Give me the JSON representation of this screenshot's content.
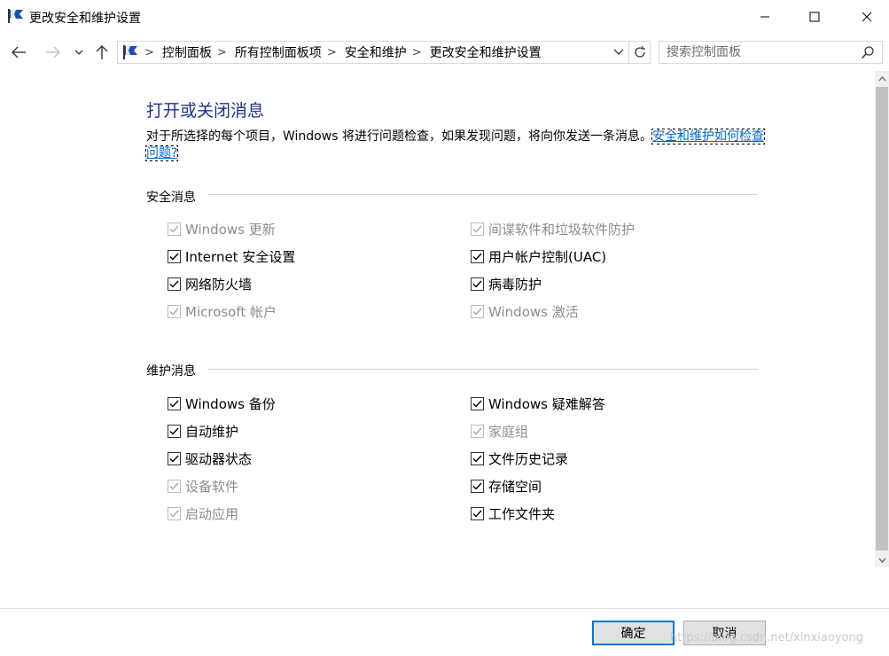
{
  "window": {
    "title": "更改安全和维护设置"
  },
  "nav": {
    "breadcrumb": [
      "控制面板",
      "所有控制面板项",
      "安全和维护",
      "更改安全和维护设置"
    ],
    "search_placeholder": "搜索控制面板"
  },
  "main": {
    "heading": "打开或关闭消息",
    "description": "对于所选择的每个项目，Windows 将进行问题检查，如果发现问题，将向你发送一条消息。",
    "help_link": "安全和维护如何检查问题?",
    "security": {
      "label": "安全消息",
      "left": [
        {
          "label": "Windows 更新",
          "checked": true,
          "enabled": false
        },
        {
          "label": "Internet 安全设置",
          "checked": true,
          "enabled": true
        },
        {
          "label": "网络防火墙",
          "checked": true,
          "enabled": true
        },
        {
          "label": "Microsoft 帐户",
          "checked": true,
          "enabled": false
        }
      ],
      "right": [
        {
          "label": "间谍软件和垃圾软件防护",
          "checked": true,
          "enabled": false
        },
        {
          "label": "用户帐户控制(UAC)",
          "checked": true,
          "enabled": true
        },
        {
          "label": "病毒防护",
          "checked": true,
          "enabled": true
        },
        {
          "label": "Windows 激活",
          "checked": true,
          "enabled": false
        }
      ]
    },
    "maintenance": {
      "label": "维护消息",
      "left": [
        {
          "label": "Windows 备份",
          "checked": true,
          "enabled": true
        },
        {
          "label": "自动维护",
          "checked": true,
          "enabled": true
        },
        {
          "label": "驱动器状态",
          "checked": true,
          "enabled": true
        },
        {
          "label": "设备软件",
          "checked": true,
          "enabled": false
        },
        {
          "label": "启动应用",
          "checked": true,
          "enabled": false
        }
      ],
      "right": [
        {
          "label": "Windows 疑难解答",
          "checked": true,
          "enabled": true
        },
        {
          "label": "家庭组",
          "checked": true,
          "enabled": false
        },
        {
          "label": "文件历史记录",
          "checked": true,
          "enabled": true
        },
        {
          "label": "存储空间",
          "checked": true,
          "enabled": true
        },
        {
          "label": "工作文件夹",
          "checked": true,
          "enabled": true
        }
      ]
    }
  },
  "footer": {
    "ok_label": "确定",
    "cancel_label": "取消",
    "watermark": "https://blog.csdn.net/xinxiaoyong"
  },
  "colors": {
    "heading": "#1e3287",
    "link": "#0066cc",
    "accent": "#0078d7"
  },
  "icons": {
    "app": "flag-icon",
    "back": "arrow-left-icon",
    "forward": "arrow-right-icon",
    "recent": "chevron-down-icon",
    "up": "arrow-up-icon",
    "refresh": "refresh-icon",
    "search": "search-icon",
    "checked": "checkmark-icon"
  }
}
